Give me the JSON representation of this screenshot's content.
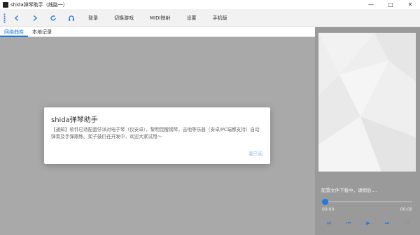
{
  "window": {
    "title": "shida弹琴助手（线路一）",
    "controls": {
      "minimize": "—",
      "maximize": "□",
      "close": "✕"
    }
  },
  "toolbar": {
    "menu": [
      "登录",
      "切换游戏",
      "MIDI映射",
      "设置",
      "手机版"
    ],
    "accent_color": "#1e7ae0"
  },
  "tabs": [
    {
      "label": "网络曲库",
      "active": true
    },
    {
      "label": "本地记录",
      "active": false
    }
  ],
  "dialog": {
    "title": "shida弹琴助手",
    "body": "【通知】软件已适配蛋仔派对电子琴（仅安卓），黎明觉醒钢琴，吉他等乐器（安卓/PC端都支持）自动弹奏及手弹跟练。架子鼓仍在开发中，欢迎大家试用～",
    "dismiss": "我已阅"
  },
  "player": {
    "status": "配置文件下载中，请稍后....",
    "progress": 0,
    "time_current": "00:00",
    "time_total": "00:00",
    "icons": {
      "shuffle": "⇄",
      "previous": "⏮",
      "play": "▶",
      "next": "⏭",
      "more": "···"
    }
  }
}
